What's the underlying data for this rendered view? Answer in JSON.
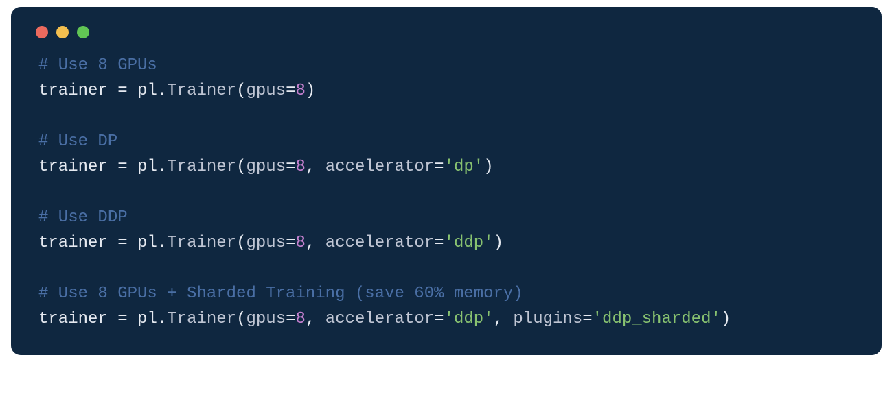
{
  "code": {
    "l1_comment": "# Use 8 GPUs",
    "l2": {
      "var": "trainer",
      "eq": " = ",
      "mod": "pl",
      "dot": ".",
      "call": "Trainer",
      "lp": "(",
      "kw1": "gpus",
      "eq1": "=",
      "num1": "8",
      "rp": ")"
    },
    "l4_comment": "# Use DP",
    "l5": {
      "var": "trainer",
      "eq": " = ",
      "mod": "pl",
      "dot": ".",
      "call": "Trainer",
      "lp": "(",
      "kw1": "gpus",
      "eq1": "=",
      "num1": "8",
      "comma1": ", ",
      "kw2": "accelerator",
      "eq2": "=",
      "str2": "'dp'",
      "rp": ")"
    },
    "l7_comment": "# Use DDP",
    "l8": {
      "var": "trainer",
      "eq": " = ",
      "mod": "pl",
      "dot": ".",
      "call": "Trainer",
      "lp": "(",
      "kw1": "gpus",
      "eq1": "=",
      "num1": "8",
      "comma1": ", ",
      "kw2": "accelerator",
      "eq2": "=",
      "str2": "'ddp'",
      "rp": ")"
    },
    "l10_comment": "# Use 8 GPUs + Sharded Training (save 60% memory)",
    "l11": {
      "var": "trainer",
      "eq": " = ",
      "mod": "pl",
      "dot": ".",
      "call": "Trainer",
      "lp": "(",
      "kw1": "gpus",
      "eq1": "=",
      "num1": "8",
      "comma1": ", ",
      "kw2": "accelerator",
      "eq2": "=",
      "str2": "'ddp'",
      "comma2": ", ",
      "kw3": "plugins",
      "eq3": "=",
      "str3": "'ddp_sharded'",
      "rp": ")"
    }
  }
}
